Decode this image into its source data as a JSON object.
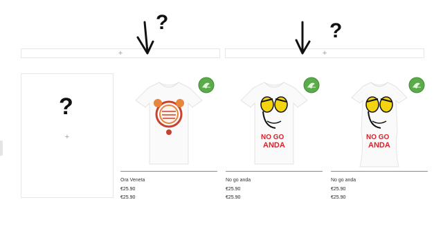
{
  "placeholders": {
    "banner_left_plus": "+",
    "banner_right_plus": "+",
    "empty_card_plus": "+"
  },
  "annotations": {
    "question_mark": "?"
  },
  "products": [
    {
      "title": "Ora Veneta",
      "price_1": "€25.90",
      "price_2": "€25.90",
      "print_text": "",
      "color_accent": "#c8412f"
    },
    {
      "title": "No go anda",
      "price_1": "€25.90",
      "price_2": "€25.90",
      "print_text": "NO GO ANDA",
      "color_accent": "#d5232a"
    },
    {
      "title": "No go anda",
      "price_1": "€25.90",
      "price_2": "€25.90",
      "print_text": "NO GO ANDA",
      "color_accent": "#d5232a"
    }
  ],
  "badge": {
    "icon": "eco-leaf-badge-icon",
    "color": "#5aab4a"
  }
}
